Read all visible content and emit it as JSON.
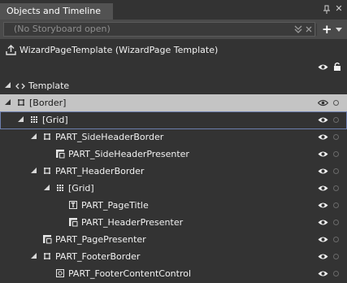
{
  "panel": {
    "title": "Objects and Timeline"
  },
  "toolbar": {
    "storyboard_placeholder": "(No Storyboard open)",
    "add_label": "+"
  },
  "scope": {
    "label": "WizardPageTemplate (WizardPage Template)"
  },
  "tree": {
    "template": {
      "label": "Template"
    },
    "nodes": [
      {
        "label": "[Border]",
        "icon": "border-icon",
        "expanded": true,
        "selected": true
      },
      {
        "label": "[Grid]",
        "icon": "grid-icon",
        "expanded": true,
        "focused": true
      },
      {
        "label": "PART_SideHeaderBorder",
        "icon": "border-icon",
        "expanded": true
      },
      {
        "label": "PART_SideHeaderPresenter",
        "icon": "content-presenter-icon"
      },
      {
        "label": "PART_HeaderBorder",
        "icon": "border-icon",
        "expanded": true
      },
      {
        "label": "[Grid]",
        "icon": "grid-icon",
        "expanded": true
      },
      {
        "label": "PART_PageTitle",
        "icon": "textblock-icon"
      },
      {
        "label": "PART_HeaderPresenter",
        "icon": "content-presenter-icon"
      },
      {
        "label": "PART_PagePresenter",
        "icon": "content-presenter-icon"
      },
      {
        "label": "PART_FooterBorder",
        "icon": "border-icon",
        "expanded": true
      },
      {
        "label": "PART_FooterContentControl",
        "icon": "content-control-icon"
      }
    ]
  },
  "colors": {
    "background": "#333333",
    "toolbar": "#4a4a4a",
    "tab": "#525252",
    "selected_row": "#c4c4c4",
    "focus_outline": "#6d7fae"
  }
}
